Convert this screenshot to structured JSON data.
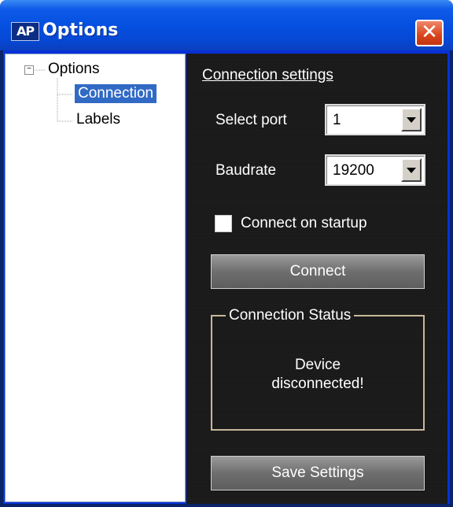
{
  "window": {
    "title": "Options",
    "app_icon": "AP",
    "close_glyph": "✕"
  },
  "tree": {
    "expander": "−",
    "root_label": "Options",
    "children": [
      {
        "label": "Connection",
        "selected": true
      },
      {
        "label": "Labels",
        "selected": false
      }
    ]
  },
  "connection": {
    "section_title": "Connection settings",
    "port_label": "Select port",
    "port_value": "1",
    "baud_label": "Baudrate",
    "baud_value": "19200",
    "startup_label": "Connect on startup",
    "startup_checked": false,
    "connect_button": "Connect",
    "status_group": "Connection Status",
    "status_line1": "Device",
    "status_line2": "disconnected!",
    "save_button": "Save Settings"
  }
}
